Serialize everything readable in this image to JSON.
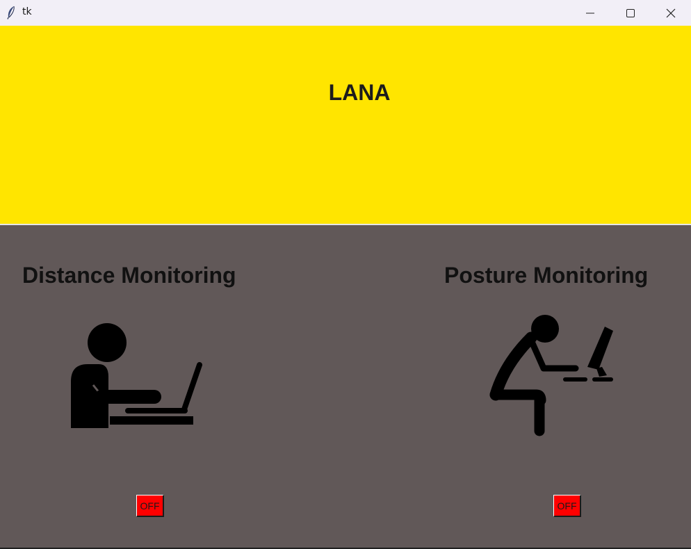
{
  "window": {
    "title": "tk",
    "icons": {
      "app": "feather-icon",
      "minimize": "minimize-icon",
      "maximize": "maximize-icon",
      "close": "close-icon"
    }
  },
  "header": {
    "title": "LANA",
    "background": "#ffe500"
  },
  "body": {
    "background": "#615858"
  },
  "panels": {
    "distance": {
      "title": "Distance Monitoring",
      "icon": "person-at-laptop-icon",
      "toggle_label": "OFF",
      "toggle_color": "#ff0000"
    },
    "posture": {
      "title": "Posture Monitoring",
      "icon": "person-hunched-at-desk-icon",
      "toggle_label": "OFF",
      "toggle_color": "#ff0000"
    }
  }
}
